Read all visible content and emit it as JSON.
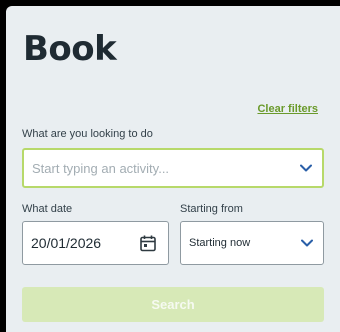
{
  "page": {
    "title": "Book",
    "clear_filters_label": "Clear filters"
  },
  "activity": {
    "label": "What are you looking to do",
    "placeholder": "Start typing an activity...",
    "value": ""
  },
  "date": {
    "label": "What date",
    "value": "20/01/2026",
    "icon": "calendar-icon"
  },
  "starting_from": {
    "label": "Starting from",
    "selected": "Starting now"
  },
  "search": {
    "label": "Search",
    "enabled": false
  },
  "icons": {
    "dropdown": "chevron-down-icon"
  },
  "colors": {
    "accent": "#6a9a2b",
    "focus_border": "#b7d96a",
    "chevron": "#2a5fa8",
    "button_disabled_bg": "#d7e9b7",
    "panel_bg": "#e9eef1"
  }
}
